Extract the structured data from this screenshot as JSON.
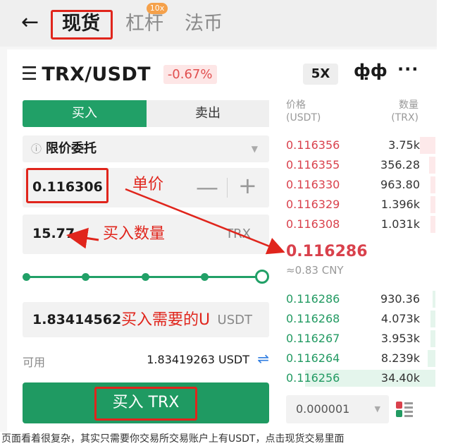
{
  "nav": {
    "back_icon": "back-arrow-icon",
    "tabs": [
      {
        "label": "现货"
      },
      {
        "label": "杠杆"
      },
      {
        "label": "法币"
      }
    ],
    "badge": "10x"
  },
  "header": {
    "pair": "TRX/USDT",
    "change": "-0.67%",
    "leverage": "5X"
  },
  "order": {
    "buy_tab": "买入",
    "sell_tab": "卖出",
    "order_type": "限价委托",
    "price": "0.116306",
    "quantity": "15.77",
    "quantity_unit": "TRX",
    "total": "1.83414562",
    "total_unit": "USDT",
    "available_label": "可用",
    "available_value": "1.83419263 USDT",
    "slider_percent": 100,
    "buy_button": "买入 TRX"
  },
  "annotations": {
    "price": "单价",
    "quantity": "买入数量",
    "total": "买入需要的U"
  },
  "orderbook": {
    "price_header": "价格",
    "price_unit": "(USDT)",
    "qty_header": "数量",
    "qty_unit": "(TRX)",
    "asks": [
      {
        "price": "0.116356",
        "qty": "3.75k",
        "depth": 0.1
      },
      {
        "price": "0.116355",
        "qty": "356.28",
        "depth": 0.04
      },
      {
        "price": "0.116330",
        "qty": "963.80",
        "depth": 0.03
      },
      {
        "price": "0.116329",
        "qty": "1.396k",
        "depth": 0.03
      },
      {
        "price": "0.116308",
        "qty": "1.031k",
        "depth": 0.03
      }
    ],
    "last_price": "0.116286",
    "last_price_cny": "≈0.83 CNY",
    "bids": [
      {
        "price": "0.116286",
        "qty": "930.36",
        "depth": 0.02
      },
      {
        "price": "0.116268",
        "qty": "4.073k",
        "depth": 0.03
      },
      {
        "price": "0.116267",
        "qty": "3.953k",
        "depth": 0.03
      },
      {
        "price": "0.116264",
        "qty": "8.239k",
        "depth": 0.05
      },
      {
        "price": "0.116256",
        "qty": "34.40k",
        "depth": 0.85
      }
    ],
    "precision": "0.000001"
  },
  "caption": "页面看着很复杂，其实只需要你交易所交易账户上有USDT，点击现货交易里面"
}
